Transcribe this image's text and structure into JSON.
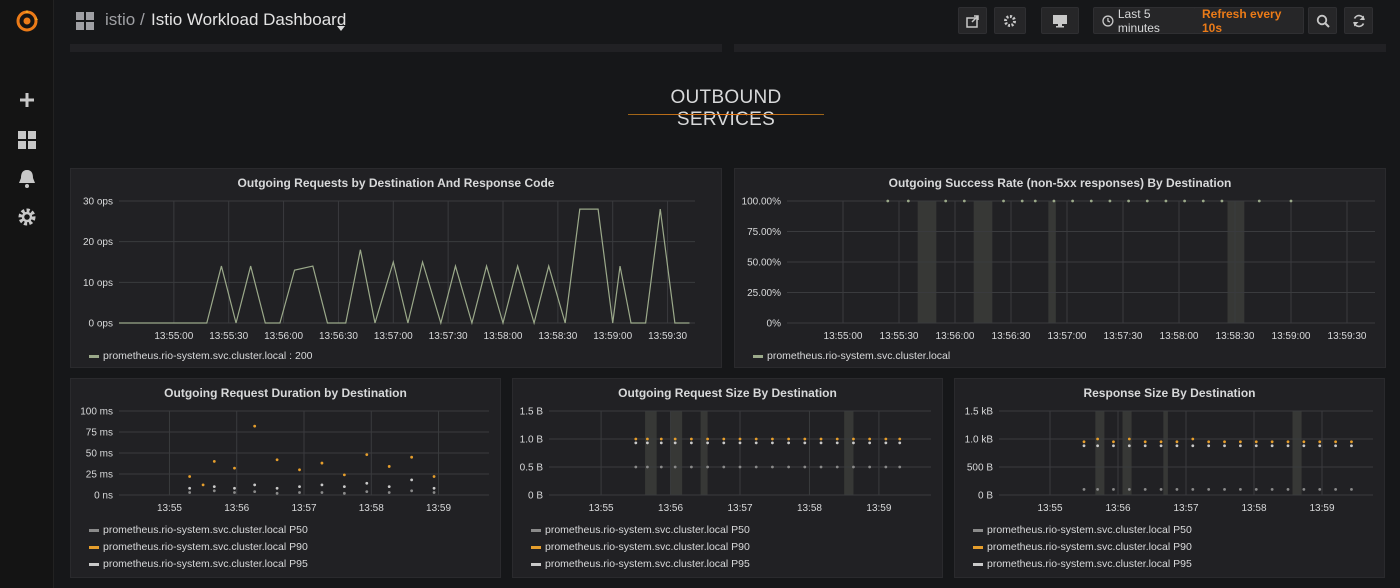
{
  "nav": {
    "breadcrumb_folder": "istio",
    "breadcrumb_sep": "/",
    "dashboard_title": "Istio Workload Dashboard",
    "time_range": "Last 5 minutes",
    "refresh": "Refresh every 10s"
  },
  "sidebar": {
    "items": [
      "grafana-logo-icon",
      "plus-icon",
      "dashboards-icon",
      "bell-icon",
      "gear-icon"
    ]
  },
  "section": {
    "title": "OUTBOUND SERVICES"
  },
  "colors": {
    "series1": "#9ba98a",
    "p50": "#8a8a8a",
    "p90": "#e69e2c",
    "p95": "#c9c9c9",
    "accent": "#eb7b18",
    "panel": "#212124"
  },
  "panels": {
    "requests": {
      "title": "Outgoing Requests by Destination And Response Code",
      "legend": "prometheus.rio-system.svc.cluster.local : 200"
    },
    "success": {
      "title": "Outgoing Success Rate (non-5xx responses) By Destination",
      "legend": "prometheus.rio-system.svc.cluster.local"
    },
    "duration": {
      "title": "Outgoing Request Duration by Destination",
      "legend": [
        "prometheus.rio-system.svc.cluster.local P50",
        "prometheus.rio-system.svc.cluster.local P90",
        "prometheus.rio-system.svc.cluster.local P95"
      ]
    },
    "reqsize": {
      "title": "Outgoing Request Size By Destination",
      "legend": [
        "prometheus.rio-system.svc.cluster.local P50",
        "prometheus.rio-system.svc.cluster.local P90",
        "prometheus.rio-system.svc.cluster.local P95"
      ]
    },
    "respsize": {
      "title": "Response Size By Destination",
      "legend": [
        "prometheus.rio-system.svc.cluster.local P50",
        "prometheus.rio-system.svc.cluster.local P90",
        "prometheus.rio-system.svc.cluster.local P95"
      ]
    }
  },
  "chart_data": [
    {
      "type": "line",
      "title": "Outgoing Requests by Destination And Response Code",
      "x_ticks": [
        "13:55:00",
        "13:55:30",
        "13:56:00",
        "13:56:30",
        "13:57:00",
        "13:57:30",
        "13:58:00",
        "13:58:30",
        "13:59:00",
        "13:59:30"
      ],
      "y_ticks": [
        "0 ops",
        "10 ops",
        "20 ops",
        "30 ops"
      ],
      "ylim": [
        0,
        30
      ],
      "xlim_sec": [
        -30,
        285
      ],
      "series": [
        {
          "name": "prometheus.rio-system.svc.cluster.local : 200",
          "x_sec": [
            -30,
            18,
            26,
            34,
            42,
            50,
            58,
            66,
            76,
            84,
            94,
            102,
            110,
            120,
            128,
            136,
            146,
            154,
            163,
            171,
            180,
            188,
            197,
            205,
            214,
            222,
            232,
            240,
            244,
            250,
            258,
            266,
            274,
            282
          ],
          "values": [
            0,
            0,
            14,
            0,
            14,
            0,
            0,
            13,
            14,
            0,
            0,
            18,
            0,
            15,
            0,
            15,
            0,
            14,
            0,
            14,
            0,
            14,
            0,
            14,
            0,
            28,
            28,
            0,
            14,
            0,
            0,
            28,
            0,
            0
          ]
        }
      ]
    },
    {
      "type": "scatter",
      "title": "Outgoing Success Rate (non-5xx responses) By Destination",
      "x_ticks": [
        "13:55:00",
        "13:55:30",
        "13:56:00",
        "13:56:30",
        "13:57:00",
        "13:57:30",
        "13:58:00",
        "13:58:30",
        "13:59:00",
        "13:59:30"
      ],
      "y_ticks": [
        "0%",
        "25.00%",
        "50.00%",
        "75.00%",
        "100.00%"
      ],
      "ylim": [
        0,
        100
      ],
      "xlim_sec": [
        -30,
        285
      ],
      "bands_sec": [
        [
          40,
          50
        ],
        [
          70,
          80
        ],
        [
          110,
          114
        ],
        [
          206,
          215
        ]
      ],
      "series": [
        {
          "name": "prometheus.rio-system.svc.cluster.local",
          "x_sec": [
            24,
            35,
            55,
            65,
            86,
            96,
            103,
            113,
            123,
            133,
            143,
            153,
            163,
            173,
            183,
            193,
            203,
            223,
            240
          ],
          "values": [
            100,
            100,
            100,
            100,
            100,
            100,
            100,
            100,
            100,
            100,
            100,
            100,
            100,
            100,
            100,
            100,
            100,
            100,
            100
          ]
        }
      ]
    },
    {
      "type": "scatter",
      "title": "Outgoing Request Duration by Destination",
      "x_ticks": [
        "13:55",
        "13:56",
        "13:57",
        "13:58",
        "13:59"
      ],
      "y_ticks": [
        "0 ns",
        "25 ms",
        "50 ms",
        "75 ms",
        "100 ms"
      ],
      "ylim": [
        0,
        100
      ],
      "xlim_sec": [
        -45,
        285
      ],
      "series": [
        {
          "name": "prometheus.rio-system.svc.cluster.local P50",
          "x_sec": [
            18,
            40,
            58,
            76,
            96,
            116,
            136,
            156,
            176,
            196,
            216,
            236
          ],
          "values": [
            3,
            5,
            3,
            4,
            2,
            3,
            3,
            2,
            4,
            3,
            5,
            3
          ]
        },
        {
          "name": "prometheus.rio-system.svc.cluster.local P90",
          "x_sec": [
            18,
            30,
            40,
            58,
            76,
            96,
            116,
            136,
            156,
            176,
            196,
            216,
            236
          ],
          "values": [
            22,
            12,
            40,
            32,
            82,
            42,
            30,
            38,
            24,
            48,
            34,
            45,
            22
          ]
        },
        {
          "name": "prometheus.rio-system.svc.cluster.local P95",
          "x_sec": [
            18,
            40,
            58,
            76,
            96,
            116,
            136,
            156,
            176,
            196,
            216,
            236
          ],
          "values": [
            8,
            10,
            8,
            12,
            8,
            10,
            12,
            10,
            14,
            10,
            18,
            8
          ]
        }
      ]
    },
    {
      "type": "scatter",
      "title": "Outgoing Request Size By Destination",
      "x_ticks": [
        "13:55",
        "13:56",
        "13:57",
        "13:58",
        "13:59"
      ],
      "y_ticks": [
        "0 B",
        "0.5 B",
        "1.0 B",
        "1.5 B"
      ],
      "ylim": [
        0,
        1.5
      ],
      "xlim_sec": [
        -45,
        285
      ],
      "bands_sec": [
        [
          38,
          48
        ],
        [
          60,
          70
        ],
        [
          86,
          92
        ],
        [
          210,
          218
        ]
      ],
      "series": [
        {
          "name": "prometheus.rio-system.svc.cluster.local P50",
          "x_sec": [
            30,
            40,
            52,
            64,
            78,
            92,
            106,
            120,
            134,
            148,
            162,
            176,
            190,
            204,
            218,
            232,
            246,
            258
          ],
          "values": [
            0.5,
            0.5,
            0.5,
            0.5,
            0.5,
            0.5,
            0.5,
            0.5,
            0.5,
            0.5,
            0.5,
            0.5,
            0.5,
            0.5,
            0.5,
            0.5,
            0.5,
            0.5
          ]
        },
        {
          "name": "prometheus.rio-system.svc.cluster.local P90",
          "x_sec": [
            30,
            40,
            52,
            64,
            78,
            92,
            106,
            120,
            134,
            148,
            162,
            176,
            190,
            204,
            218,
            232,
            246,
            258
          ],
          "values": [
            1.0,
            1.0,
            1.0,
            1.0,
            1.0,
            1.0,
            1.0,
            1.0,
            1.0,
            1.0,
            1.0,
            1.0,
            1.0,
            1.0,
            1.0,
            1.0,
            1.0,
            1.0
          ]
        },
        {
          "name": "prometheus.rio-system.svc.cluster.local P95",
          "x_sec": [
            30,
            40,
            52,
            64,
            78,
            92,
            106,
            120,
            134,
            148,
            162,
            176,
            190,
            204,
            218,
            232,
            246,
            258
          ],
          "values": [
            0.93,
            0.93,
            0.93,
            0.93,
            0.93,
            0.93,
            0.93,
            0.93,
            0.93,
            0.93,
            0.93,
            0.93,
            0.93,
            0.93,
            0.93,
            0.93,
            0.93,
            0.93
          ]
        }
      ]
    },
    {
      "type": "scatter",
      "title": "Response Size By Destination",
      "x_ticks": [
        "13:55",
        "13:56",
        "13:57",
        "13:58",
        "13:59"
      ],
      "y_ticks": [
        "0 B",
        "500 B",
        "1.0 kB",
        "1.5 kB"
      ],
      "ylim": [
        0,
        1500
      ],
      "xlim_sec": [
        -45,
        285
      ],
      "bands_sec": [
        [
          40,
          48
        ],
        [
          64,
          72
        ],
        [
          100,
          104
        ],
        [
          214,
          222
        ]
      ],
      "series": [
        {
          "name": "prometheus.rio-system.svc.cluster.local P50",
          "x_sec": [
            30,
            42,
            56,
            70,
            84,
            98,
            112,
            126,
            140,
            154,
            168,
            182,
            196,
            210,
            224,
            238,
            252,
            266
          ],
          "values": [
            100,
            100,
            100,
            100,
            100,
            100,
            100,
            100,
            100,
            100,
            100,
            100,
            100,
            100,
            100,
            100,
            100,
            100
          ]
        },
        {
          "name": "prometheus.rio-system.svc.cluster.local P90",
          "x_sec": [
            30,
            42,
            56,
            70,
            84,
            98,
            112,
            126,
            140,
            154,
            168,
            182,
            196,
            210,
            224,
            238,
            252,
            266
          ],
          "values": [
            950,
            1000,
            950,
            1000,
            950,
            950,
            950,
            1000,
            950,
            950,
            950,
            950,
            950,
            950,
            950,
            950,
            950,
            950
          ]
        },
        {
          "name": "prometheus.rio-system.svc.cluster.local P95",
          "x_sec": [
            30,
            42,
            56,
            70,
            84,
            98,
            112,
            126,
            140,
            154,
            168,
            182,
            196,
            210,
            224,
            238,
            252,
            266
          ],
          "values": [
            880,
            880,
            880,
            880,
            880,
            880,
            880,
            880,
            880,
            880,
            880,
            880,
            880,
            880,
            880,
            880,
            880,
            880
          ]
        }
      ]
    }
  ]
}
